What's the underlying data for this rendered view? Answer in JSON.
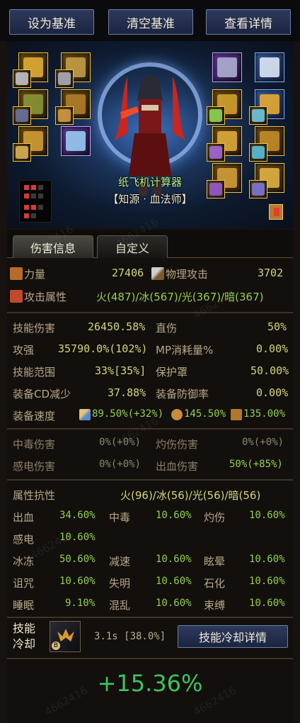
{
  "toolbar": {
    "set_baseline": "设为基准",
    "clear_baseline": "清空基准",
    "view_details": "查看详情"
  },
  "hero": {
    "calculator_name": "纸飞机计算器",
    "character_class": "【知源 · 血法师】"
  },
  "tabs": {
    "damage_info": "伤害信息",
    "custom": "自定义"
  },
  "primary": {
    "strength_label": "力量",
    "strength_value": "27406",
    "phys_atk_label": "物理攻击",
    "phys_atk_value": "3702",
    "attack_attr_label": "攻击属性",
    "attack_attr_value": "火(487)/冰(567)/光(367)/暗(367)"
  },
  "stats": [
    {
      "l1": "技能伤害",
      "v1": "26450.58%",
      "l2": "直伤",
      "v2": "50%"
    },
    {
      "l1": "攻强",
      "v1": "35790.0%(102%)",
      "l2": "MP消耗量%",
      "v2": "0.00%"
    },
    {
      "l1": "技能范围",
      "v1": "33%[35%]",
      "l2": "保护罩",
      "v2": "50.00%"
    },
    {
      "l1": "装备CD减少",
      "v1": "37.88%",
      "l2": "装备防御率",
      "v2": "0.00%"
    }
  ],
  "speed": {
    "label": "装备速度",
    "v1": "89.50%(+32%)",
    "v2": "145.50%",
    "v3": "135.00%"
  },
  "dot": [
    {
      "l1": "中毒伤害",
      "v1": "0%(+0%)",
      "l2": "灼伤伤害",
      "v2": "0%(+0%)"
    },
    {
      "l1": "感电伤害",
      "v1": "0%(+0%)",
      "l2": "出血伤害",
      "v2": "50%(+85%)"
    }
  ],
  "resist": {
    "label": "属性抗性",
    "value": "火(96)/冰(56)/光(56)/暗(56)",
    "rows": [
      [
        {
          "l": "出血",
          "v": "34.60%"
        },
        {
          "l": "中毒",
          "v": "10.60%"
        },
        {
          "l": "灼伤",
          "v": "10.60%"
        }
      ],
      [
        {
          "l": "感电",
          "v": "10.60%"
        }
      ],
      [
        {
          "l": "冰冻",
          "v": "50.60%"
        },
        {
          "l": "减速",
          "v": "10.60%"
        },
        {
          "l": "眩晕",
          "v": "10.60%"
        }
      ],
      [
        {
          "l": "诅咒",
          "v": "10.60%"
        },
        {
          "l": "失明",
          "v": "10.60%"
        },
        {
          "l": "石化",
          "v": "10.60%"
        }
      ],
      [
        {
          "l": "睡眠",
          "v": "9.10%"
        },
        {
          "l": "混乱",
          "v": "10.60%"
        },
        {
          "l": "束缚",
          "v": "10.60%"
        }
      ]
    ]
  },
  "skill": {
    "label_line1": "技能",
    "label_line2": "冷却",
    "time": "3.1s [38.0%]",
    "details_button": "技能冷却详情"
  },
  "result": {
    "delta": "+15.36%"
  },
  "watermark": "4662416",
  "colors": {
    "accent_green": "#3fc45a",
    "value_yellow": "#d2d67a",
    "highlight_green": "#92d04d"
  }
}
